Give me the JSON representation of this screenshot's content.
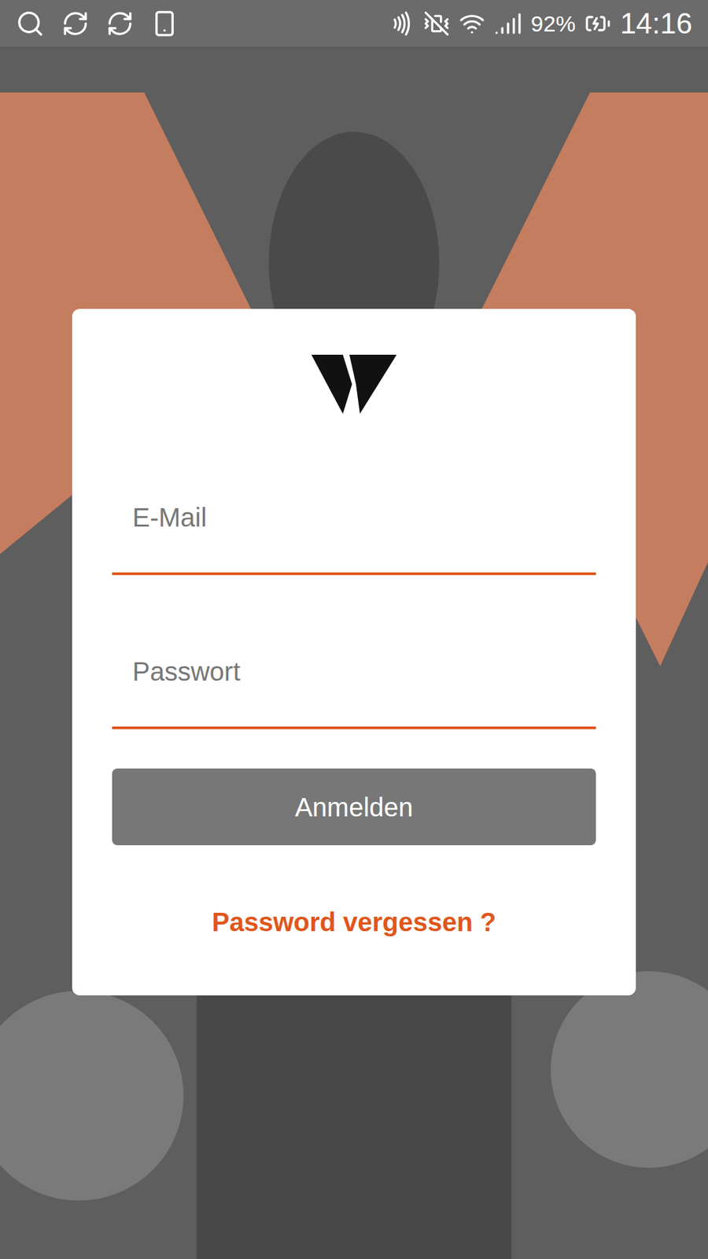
{
  "status_bar": {
    "battery": "92%",
    "time": "14:16"
  },
  "login": {
    "email": {
      "placeholder": "E-Mail",
      "value": ""
    },
    "password": {
      "placeholder": "Passwort",
      "value": ""
    },
    "submit": {
      "label": "Anmelden",
      "disabled": true
    },
    "forgot_link": "Password vergessen ?"
  }
}
